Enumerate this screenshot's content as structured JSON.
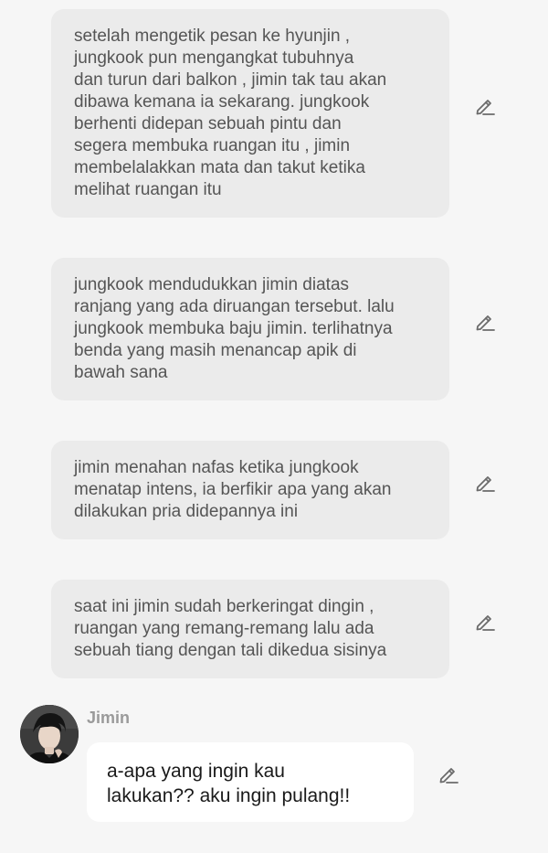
{
  "narrations": [
    {
      "text": "setelah mengetik pesan ke hyunjin ,\njungkook pun mengangkat tubuhnya\ndan turun dari balkon , jimin tak tau akan\ndibawa kemana ia sekarang. jungkook\nberhenti didepan sebuah pintu dan\nsegera membuka ruangan itu , jimin\nmembelalakkan mata dan takut ketika\nmelihat ruangan itu"
    },
    {
      "text": "jungkook mendudukkan jimin diatas\nranjang yang ada diruangan tersebut. lalu\njungkook membuka baju jimin. terlihatnya\nbenda yang masih menancap apik di\nbawah sana"
    },
    {
      "text": "jimin menahan nafas ketika jungkook\nmenatap intens, ia berfikir apa yang akan\ndilakukan pria didepannya ini"
    },
    {
      "text": "saat ini jimin sudah berkeringat dingin ,\nruangan yang remang-remang lalu ada\nsebuah tiang dengan tali dikedua sisinya"
    }
  ],
  "chat": {
    "sender": "Jimin",
    "message": "a-apa yang ingin kau\nlakukan?? aku ingin pulang!!"
  },
  "icons": {
    "edit": "pencil-edit-icon",
    "avatar": "profile-photo"
  },
  "colors": {
    "background": "#f6f6f6",
    "narration_bubble": "#ebebeb",
    "chat_bubble": "#ffffff",
    "narration_text": "#555555",
    "sender_name": "#9a9a9a"
  }
}
